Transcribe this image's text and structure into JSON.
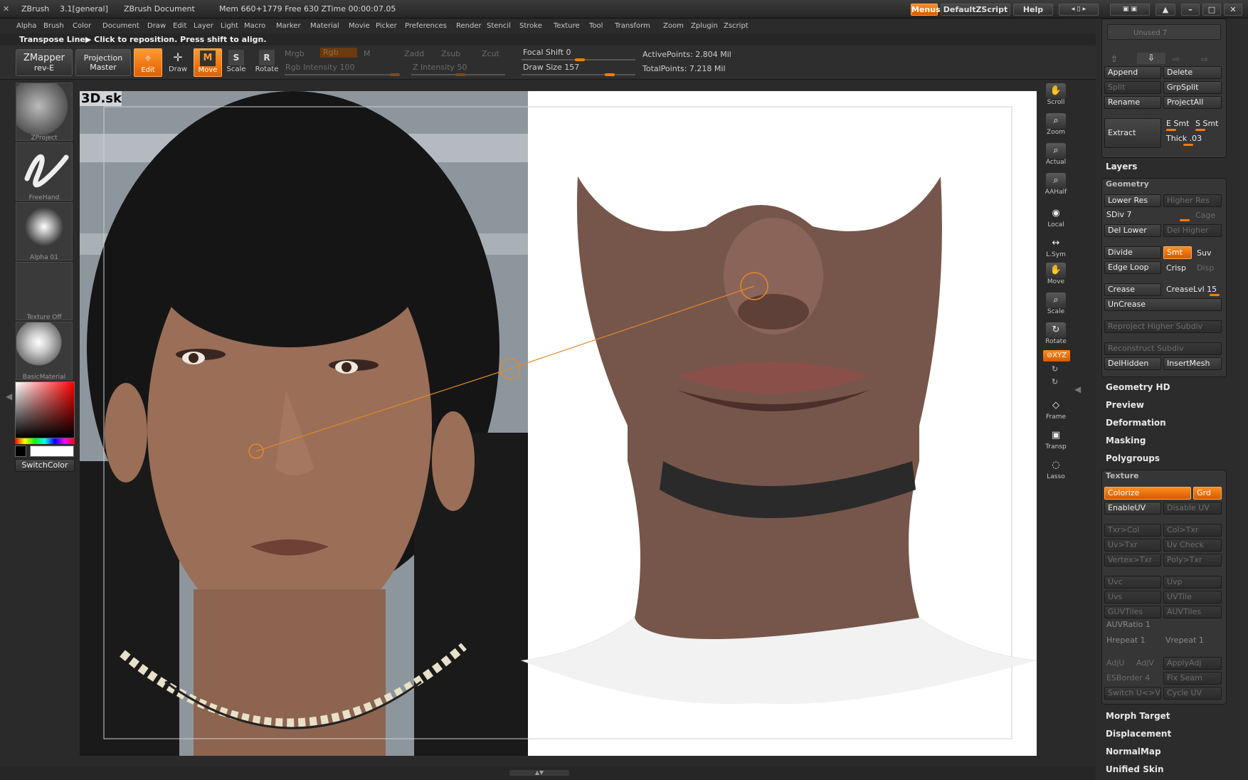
{
  "titlebar": {
    "app": "ZBrush",
    "version": "3.1[general]",
    "document": "ZBrush Document",
    "mem": "Mem 660+1779 Free 630 ZTime 00:00:07.05",
    "buttons": {
      "menus": "Menus",
      "script": "DefaultZScript",
      "help": "Help"
    }
  },
  "menubar": [
    "Alpha",
    "Brush",
    "Color",
    "Document",
    "Draw",
    "Edit",
    "Layer",
    "Light",
    "Macro",
    "Marker",
    "Material",
    "Movie",
    "Picker",
    "Preferences",
    "Render",
    "Stencil",
    "Stroke",
    "Texture",
    "Tool",
    "Transform",
    "Zoom",
    "Zplugin",
    "Zscript"
  ],
  "status": "Transpose Line▶ Click to reposition. Press shift to align.",
  "toolbar": {
    "zmapper": {
      "line1": "ZMapper",
      "line2": "rev-E"
    },
    "projection": {
      "line1": "Projection",
      "line2": "Master"
    },
    "tools": {
      "edit": "Edit",
      "draw": "Draw",
      "move": "Move",
      "scale": "Scale",
      "rotate": "Rotate"
    },
    "mrgb": "Mrgb",
    "rgb": "Rgb",
    "m": "M",
    "zadd": "Zadd",
    "zsub": "Zsub",
    "zcut": "Zcut",
    "rgb_intensity": "Rgb Intensity 100",
    "z_intensity": "Z Intensity 50",
    "focal_shift": "Focal Shift 0",
    "draw_size": "Draw Size 157",
    "active_points": "ActivePoints: 2.804 Mil",
    "total_points": "TotalPoints: 7.218 Mil",
    "focal_shift_level": 0.0,
    "draw_size_level": 0.62
  },
  "leftshelf": {
    "items": [
      "ZProject",
      "FreeHand",
      "Alpha 01",
      "Texture Off",
      "BasicMaterial"
    ],
    "switch_color": "SwitchColor"
  },
  "canvas": {
    "watermark": "3D.sk"
  },
  "rightnav": [
    "Scroll",
    "Zoom",
    "Actual",
    "AAHalf",
    "Local",
    "L.Sym",
    "Move",
    "Scale",
    "Rotate",
    "Frame",
    "Transp",
    "Lasso"
  ],
  "rightnav_xyz": "⊘XYZ",
  "panel": {
    "unused": "Unused 7",
    "subtool": {
      "append": "Append",
      "delete": "Delete",
      "split": "Split",
      "grpsplit": "GrpSplit",
      "rename": "Rename",
      "projectall": "ProjectAll",
      "extract": "Extract",
      "esmt": "E Smt",
      "ssmt": "S Smt",
      "thick": "Thick .03"
    },
    "layers": "Layers",
    "geometry": {
      "title": "Geometry",
      "lower_res": "Lower Res",
      "higher_res": "Higher Res",
      "sdiv": "SDiv 7",
      "cage": "Cage",
      "del_lower": "Del Lower",
      "del_higher": "Del Higher",
      "divide": "Divide",
      "smt": "Smt",
      "suv": "Suv",
      "edge_loop": "Edge Loop",
      "crisp": "Crisp",
      "disp": "Disp",
      "crease": "Crease",
      "creaselvl": "CreaseLvl 15",
      "uncrease": "UnCrease",
      "reproject": "Reproject Higher Subdiv",
      "reconstruct": "Reconstruct Subdiv",
      "delhidden": "DelHidden",
      "insertmesh": "InsertMesh"
    },
    "sections": [
      "Geometry HD",
      "Preview",
      "Deformation",
      "Masking",
      "Polygroups"
    ],
    "texture": {
      "title": "Texture",
      "colorize": "Colorize",
      "grd": "Grd",
      "enableuv": "EnableUV",
      "disableuv": "Disable UV",
      "txr2col": "Txr>Col",
      "col2txr": "Col>Txr",
      "uv2txr": "Uv>Txr",
      "uvcheck": "Uv Check",
      "vertex2txr": "Vertex>Txr",
      "poly2txr": "Poly>Txr",
      "uvc": "Uvc",
      "uvp": "Uvp",
      "uvs": "Uvs",
      "uvtile": "UVTile",
      "guvtiles": "GUVTiles",
      "auvtiles": "AUVTiles",
      "auvratio": "AUVRatio 1",
      "hrepeat": "Hrepeat 1",
      "vrepeat": "Vrepeat 1",
      "adju": "AdjU",
      "adjv": "AdjV",
      "applyadj": "ApplyAdj",
      "esborder": "ESBorder 4",
      "fixseam": "Fix Seam",
      "switchuv": "Switch U<>V",
      "cycleuv": "Cycle UV"
    },
    "sections_bottom": [
      "Morph Target",
      "Displacement",
      "NormalMap",
      "Unified Skin"
    ]
  },
  "colors": {
    "accent": "#ff7a00",
    "transpose_line": "#e08a2a"
  }
}
